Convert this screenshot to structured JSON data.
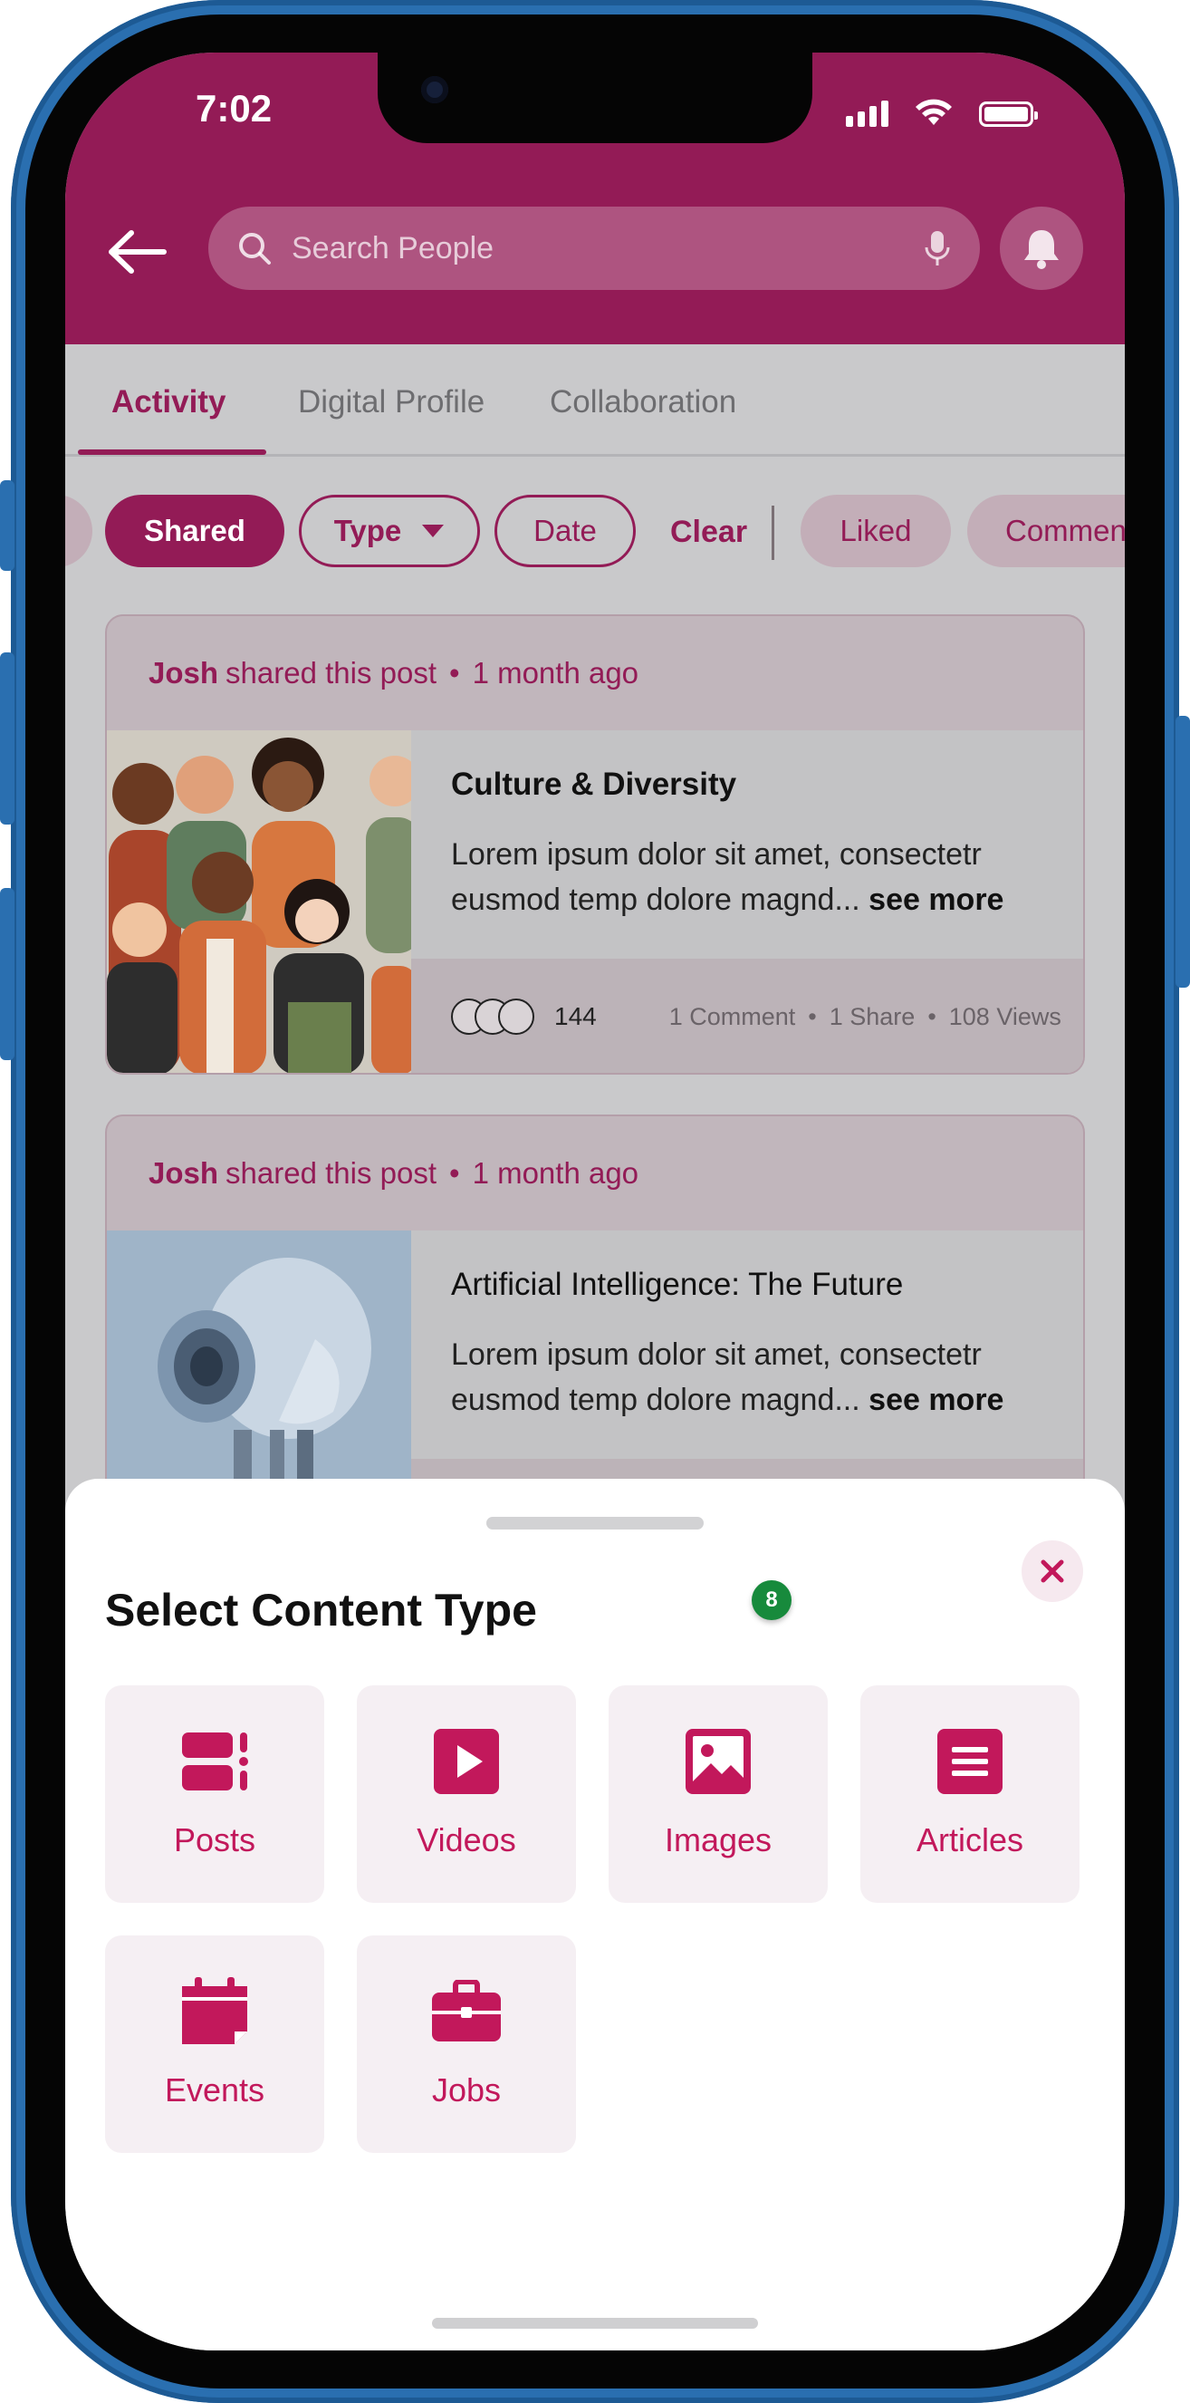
{
  "status_bar": {
    "time": "7:02"
  },
  "header": {
    "search_placeholder": "Search People"
  },
  "tabs": [
    {
      "label": "Activity",
      "active": true
    },
    {
      "label": "Digital Profile",
      "active": false
    },
    {
      "label": "Collaboration",
      "active": false
    }
  ],
  "filters": {
    "shared": "Shared",
    "type": "Type",
    "date": "Date",
    "clear": "Clear",
    "liked": "Liked",
    "commented": "Commen"
  },
  "posts": [
    {
      "author": "Josh",
      "action": "shared this post",
      "time_ago": "1 month ago",
      "title": "Culture & Diversity",
      "excerpt": "Lorem ipsum dolor sit amet, consectetr eusmod temp dolore magnd...",
      "see_more": "see more",
      "reactions_count": "144",
      "comments": "1 Comment",
      "shares": "1 Share",
      "views": "108 Views"
    },
    {
      "author": "Josh",
      "action": "shared this post",
      "time_ago": "1 month ago",
      "title": "Artificial Intelligence: The Future",
      "excerpt": "Lorem ipsum dolor sit amet, consectetr eusmod temp dolore magnd...",
      "see_more": "see more"
    }
  ],
  "sheet": {
    "title": "Select Content Type",
    "badge": "8",
    "options": [
      {
        "label": "Posts",
        "icon": "posts-icon"
      },
      {
        "label": "Videos",
        "icon": "video-icon"
      },
      {
        "label": "Images",
        "icon": "image-icon"
      },
      {
        "label": "Articles",
        "icon": "article-icon"
      },
      {
        "label": "Events",
        "icon": "calendar-icon"
      },
      {
        "label": "Jobs",
        "icon": "briefcase-icon"
      }
    ]
  },
  "colors": {
    "brand": "#931b56",
    "accent": "#c2185b",
    "badge": "#178a3c"
  }
}
